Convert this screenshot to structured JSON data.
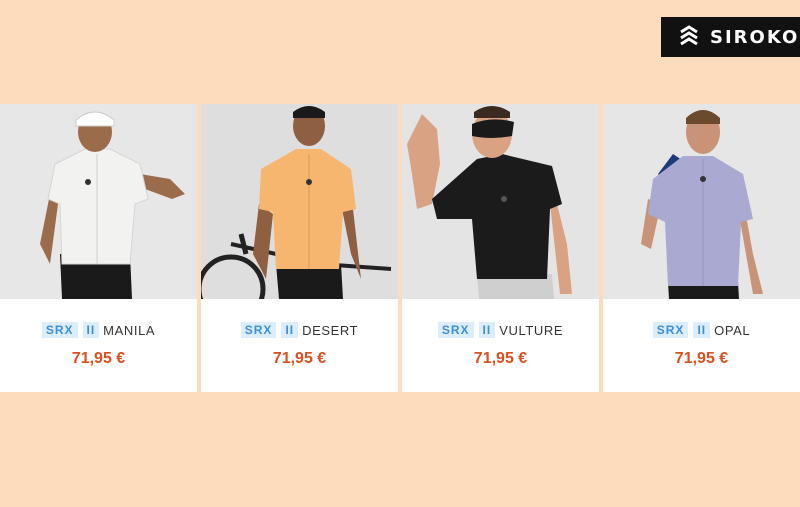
{
  "brand": {
    "name": "SIROKO",
    "logo_icon": "siroko-logo-icon"
  },
  "colors": {
    "background": "#fcdcbd",
    "price": "#d94f1e",
    "tag_text": "#3b8fd8",
    "tag_bg": "#dceefe"
  },
  "products": [
    {
      "line": "SRX",
      "series": "II",
      "model": "MANILA",
      "price": "71,95 €",
      "jersey_color": "#f2f2f0"
    },
    {
      "line": "SRX",
      "series": "II",
      "model": "DESERT",
      "price": "71,95 €",
      "jersey_color": "#f7b66f"
    },
    {
      "line": "SRX",
      "series": "II",
      "model": "VULTURE",
      "price": "71,95 €",
      "jersey_color": "#1b1b1b"
    },
    {
      "line": "SRX",
      "series": "II",
      "model": "OPAL",
      "price": "71,95 €",
      "jersey_color": "#a9a9d2"
    }
  ]
}
